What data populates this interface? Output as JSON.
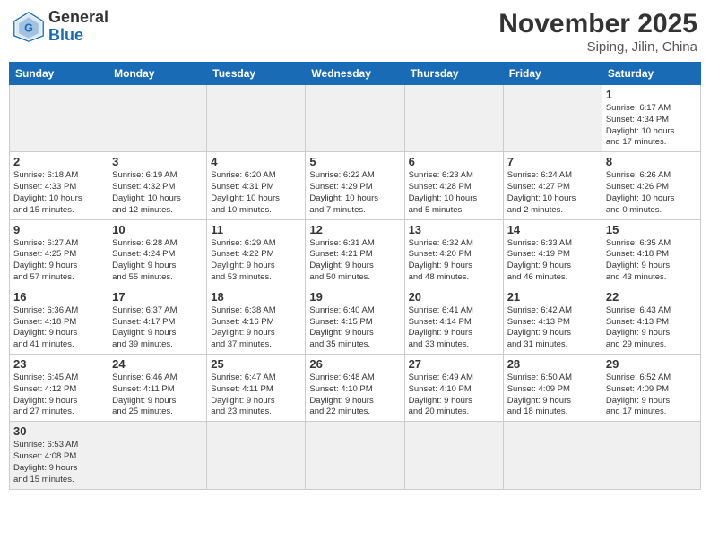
{
  "header": {
    "logo_general": "General",
    "logo_blue": "Blue",
    "month_title": "November 2025",
    "location": "Siping, Jilin, China"
  },
  "weekdays": [
    "Sunday",
    "Monday",
    "Tuesday",
    "Wednesday",
    "Thursday",
    "Friday",
    "Saturday"
  ],
  "weeks": [
    [
      {
        "day": "",
        "info": "",
        "empty": true
      },
      {
        "day": "",
        "info": "",
        "empty": true
      },
      {
        "day": "",
        "info": "",
        "empty": true
      },
      {
        "day": "",
        "info": "",
        "empty": true
      },
      {
        "day": "",
        "info": "",
        "empty": true
      },
      {
        "day": "",
        "info": "",
        "empty": true
      },
      {
        "day": "1",
        "info": "Sunrise: 6:17 AM\nSunset: 4:34 PM\nDaylight: 10 hours\nand 17 minutes."
      }
    ],
    [
      {
        "day": "2",
        "info": "Sunrise: 6:18 AM\nSunset: 4:33 PM\nDaylight: 10 hours\nand 15 minutes."
      },
      {
        "day": "3",
        "info": "Sunrise: 6:19 AM\nSunset: 4:32 PM\nDaylight: 10 hours\nand 12 minutes."
      },
      {
        "day": "4",
        "info": "Sunrise: 6:20 AM\nSunset: 4:31 PM\nDaylight: 10 hours\nand 10 minutes."
      },
      {
        "day": "5",
        "info": "Sunrise: 6:22 AM\nSunset: 4:29 PM\nDaylight: 10 hours\nand 7 minutes."
      },
      {
        "day": "6",
        "info": "Sunrise: 6:23 AM\nSunset: 4:28 PM\nDaylight: 10 hours\nand 5 minutes."
      },
      {
        "day": "7",
        "info": "Sunrise: 6:24 AM\nSunset: 4:27 PM\nDaylight: 10 hours\nand 2 minutes."
      },
      {
        "day": "8",
        "info": "Sunrise: 6:26 AM\nSunset: 4:26 PM\nDaylight: 10 hours\nand 0 minutes."
      }
    ],
    [
      {
        "day": "9",
        "info": "Sunrise: 6:27 AM\nSunset: 4:25 PM\nDaylight: 9 hours\nand 57 minutes."
      },
      {
        "day": "10",
        "info": "Sunrise: 6:28 AM\nSunset: 4:24 PM\nDaylight: 9 hours\nand 55 minutes."
      },
      {
        "day": "11",
        "info": "Sunrise: 6:29 AM\nSunset: 4:22 PM\nDaylight: 9 hours\nand 53 minutes."
      },
      {
        "day": "12",
        "info": "Sunrise: 6:31 AM\nSunset: 4:21 PM\nDaylight: 9 hours\nand 50 minutes."
      },
      {
        "day": "13",
        "info": "Sunrise: 6:32 AM\nSunset: 4:20 PM\nDaylight: 9 hours\nand 48 minutes."
      },
      {
        "day": "14",
        "info": "Sunrise: 6:33 AM\nSunset: 4:19 PM\nDaylight: 9 hours\nand 46 minutes."
      },
      {
        "day": "15",
        "info": "Sunrise: 6:35 AM\nSunset: 4:18 PM\nDaylight: 9 hours\nand 43 minutes."
      }
    ],
    [
      {
        "day": "16",
        "info": "Sunrise: 6:36 AM\nSunset: 4:18 PM\nDaylight: 9 hours\nand 41 minutes."
      },
      {
        "day": "17",
        "info": "Sunrise: 6:37 AM\nSunset: 4:17 PM\nDaylight: 9 hours\nand 39 minutes."
      },
      {
        "day": "18",
        "info": "Sunrise: 6:38 AM\nSunset: 4:16 PM\nDaylight: 9 hours\nand 37 minutes."
      },
      {
        "day": "19",
        "info": "Sunrise: 6:40 AM\nSunset: 4:15 PM\nDaylight: 9 hours\nand 35 minutes."
      },
      {
        "day": "20",
        "info": "Sunrise: 6:41 AM\nSunset: 4:14 PM\nDaylight: 9 hours\nand 33 minutes."
      },
      {
        "day": "21",
        "info": "Sunrise: 6:42 AM\nSunset: 4:13 PM\nDaylight: 9 hours\nand 31 minutes."
      },
      {
        "day": "22",
        "info": "Sunrise: 6:43 AM\nSunset: 4:13 PM\nDaylight: 9 hours\nand 29 minutes."
      }
    ],
    [
      {
        "day": "23",
        "info": "Sunrise: 6:45 AM\nSunset: 4:12 PM\nDaylight: 9 hours\nand 27 minutes."
      },
      {
        "day": "24",
        "info": "Sunrise: 6:46 AM\nSunset: 4:11 PM\nDaylight: 9 hours\nand 25 minutes."
      },
      {
        "day": "25",
        "info": "Sunrise: 6:47 AM\nSunset: 4:11 PM\nDaylight: 9 hours\nand 23 minutes."
      },
      {
        "day": "26",
        "info": "Sunrise: 6:48 AM\nSunset: 4:10 PM\nDaylight: 9 hours\nand 22 minutes."
      },
      {
        "day": "27",
        "info": "Sunrise: 6:49 AM\nSunset: 4:10 PM\nDaylight: 9 hours\nand 20 minutes."
      },
      {
        "day": "28",
        "info": "Sunrise: 6:50 AM\nSunset: 4:09 PM\nDaylight: 9 hours\nand 18 minutes."
      },
      {
        "day": "29",
        "info": "Sunrise: 6:52 AM\nSunset: 4:09 PM\nDaylight: 9 hours\nand 17 minutes."
      }
    ],
    [
      {
        "day": "30",
        "info": "Sunrise: 6:53 AM\nSunset: 4:08 PM\nDaylight: 9 hours\nand 15 minutes."
      },
      {
        "day": "",
        "info": "",
        "empty": true
      },
      {
        "day": "",
        "info": "",
        "empty": true
      },
      {
        "day": "",
        "info": "",
        "empty": true
      },
      {
        "day": "",
        "info": "",
        "empty": true
      },
      {
        "day": "",
        "info": "",
        "empty": true
      },
      {
        "day": "",
        "info": "",
        "empty": true
      }
    ]
  ]
}
